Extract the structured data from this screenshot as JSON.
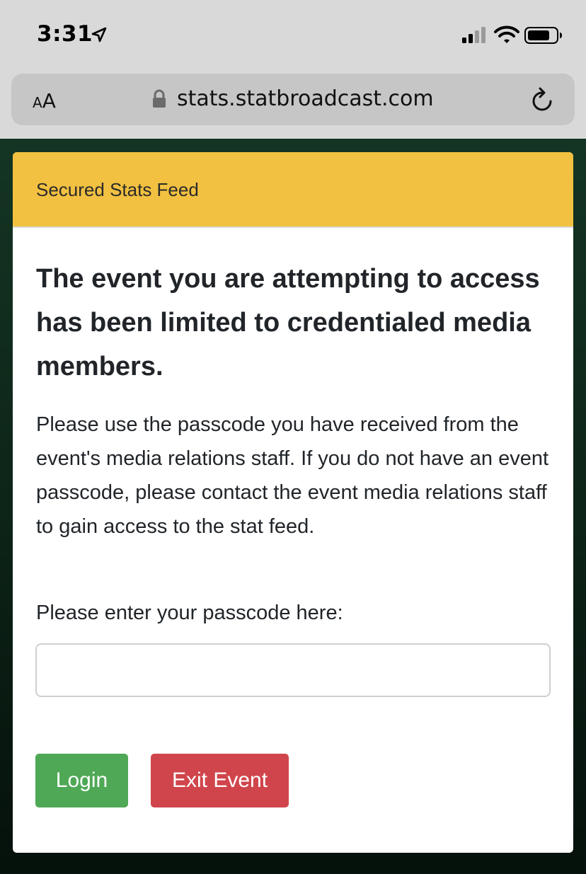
{
  "status_bar": {
    "time": "3:31",
    "icons": [
      "location-arrow-icon",
      "cellular-signal-icon",
      "wifi-icon",
      "battery-icon"
    ]
  },
  "browser": {
    "text_size_button_small": "A",
    "text_size_button_large": "A",
    "url": "stats.statbroadcast.com",
    "icons": [
      "lock-icon",
      "reload-icon"
    ]
  },
  "card": {
    "header_title": "Secured Stats Feed",
    "heading": "The event you are attempting to access has been limited to credentialed media members.",
    "body": "Please use the passcode you have received from the event's media relations staff. If you do not have an event passcode, please contact the event media relations staff to gain access to the stat feed.",
    "passcode_label": "Please enter your passcode here:",
    "passcode_value": "",
    "passcode_placeholder": "",
    "login_label": "Login",
    "exit_label": "Exit Event"
  },
  "colors": {
    "header": "#f2c141",
    "login_button": "#4fa856",
    "exit_button": "#d0454c",
    "page_background": "#143524"
  }
}
